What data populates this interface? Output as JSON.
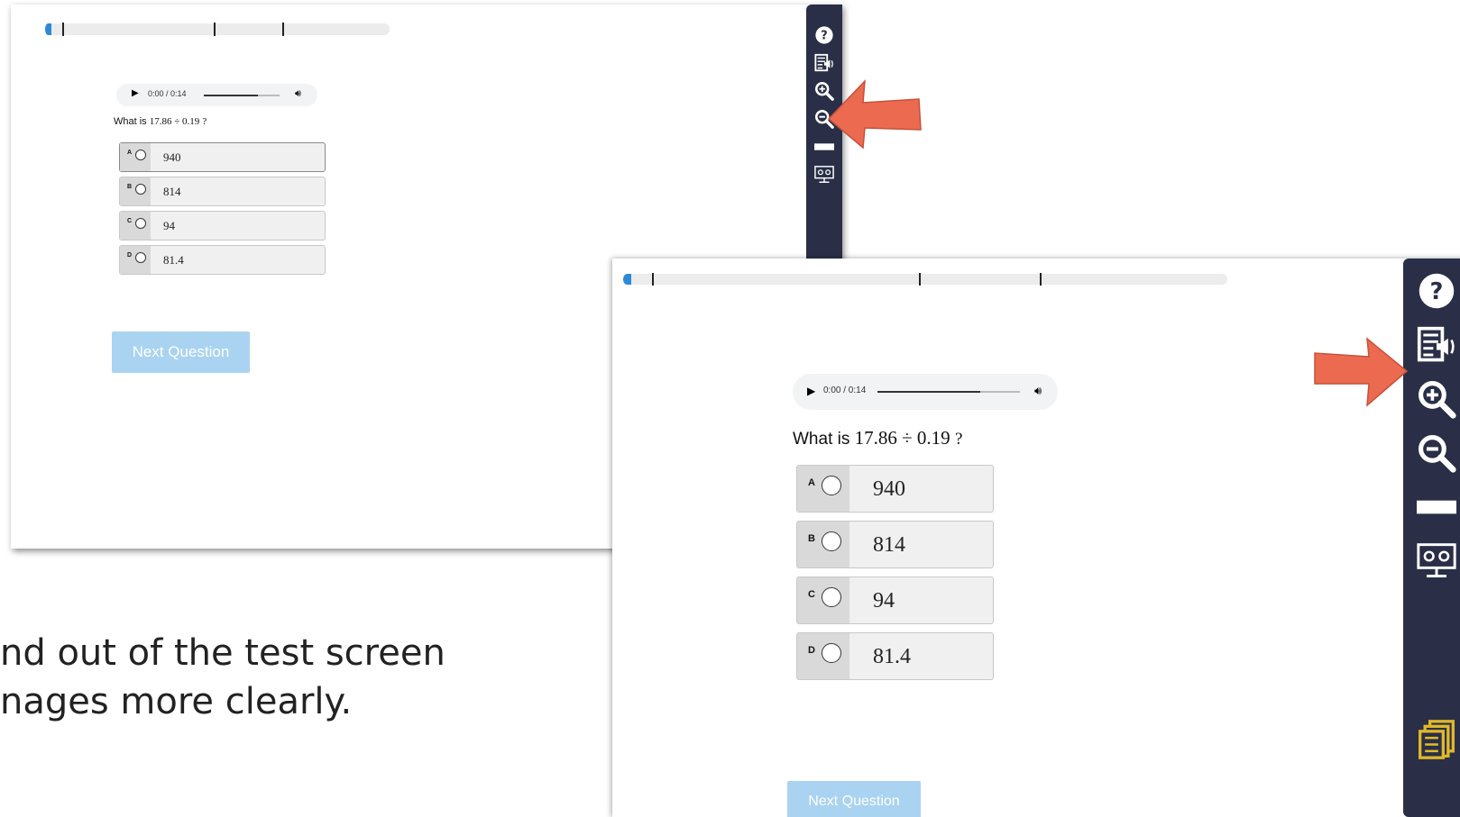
{
  "caption": {
    "line1": "nd out of the test screen",
    "line2": "nages more clearly."
  },
  "screen": {
    "audio": {
      "time": "0:00 / 0:14",
      "progress": 0.72
    },
    "question": {
      "prefix": "What is",
      "expression": "17.86 ÷ 0.19",
      "suffix": "?"
    },
    "options": [
      {
        "letter": "A",
        "value": "940"
      },
      {
        "letter": "B",
        "value": "814"
      },
      {
        "letter": "C",
        "value": "94"
      },
      {
        "letter": "D",
        "value": "81.4"
      }
    ],
    "next_label": "Next Question"
  },
  "toolbar": {
    "icons": [
      "help-icon",
      "text-to-speech-icon",
      "zoom-in-icon",
      "zoom-out-icon",
      "line-reader-icon",
      "screen-mask-icon",
      "notes-icon"
    ]
  },
  "annotations": {
    "first": "arrow pointing to zoom-out-icon",
    "second": "arrow pointing to zoom-in-icon"
  },
  "colors": {
    "toolbar": "#2a2f47",
    "next_button": "#a9d3f1",
    "progress_marker": "#2e8ad6",
    "arrow": "#ec6a4f",
    "notes_icon": "#e0b92a"
  }
}
